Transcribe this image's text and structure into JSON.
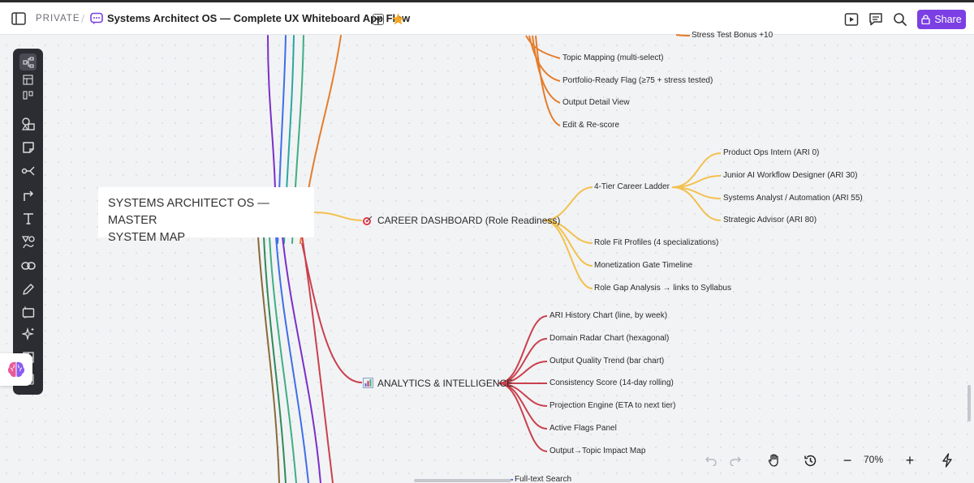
{
  "topbar": {
    "privacy": "PRIVATE",
    "separator": "/",
    "title": "Systems Architect OS — Complete UX Whiteboard App Flow",
    "share_label": "Share"
  },
  "colors": {
    "accent": "#7b3fe4",
    "orange_branch": "#e47d2c",
    "yellow_branch": "#f2c14e",
    "red_branch": "#c9414d",
    "star": "#f5a623"
  },
  "root": {
    "line1": "SYSTEMS ARCHITECT OS — MASTER",
    "line2": "SYSTEM MAP"
  },
  "nodes": {
    "stress_test": "Stress Test Bonus +10",
    "topic_mapping": "Topic Mapping (multi-select)",
    "portfolio_flag": "Portfolio-Ready Flag (≥75 + stress tested)",
    "output_detail": "Output Detail View",
    "edit_rescore": "Edit & Re-score",
    "career_dashboard": "CAREER DASHBOARD (Role Readiness)",
    "career_ladder": "4-Tier Career Ladder",
    "product_ops": "Product Ops Intern (ARI 0)",
    "junior_ai": "Junior AI Workflow Designer (ARI 30)",
    "systems_analyst": "Systems Analyst / Automation (ARI 55)",
    "strategic_advisor": "Strategic Advisor (ARI 80)",
    "role_fit": "Role Fit Profiles (4 specializations)",
    "monetization": "Monetization Gate Timeline",
    "role_gap": "Role Gap Analysis → links to Syllabus",
    "analytics": "ANALYTICS & INTELLIGENCE",
    "ari_history": "ARI History Chart (line, by week)",
    "domain_radar": "Domain Radar Chart (hexagonal)",
    "output_quality": "Output Quality Trend (bar chart)",
    "consistency": "Consistency Score (14-day rolling)",
    "projection": "Projection Engine (ETA to next tier)",
    "active_flags": "Active Flags Panel",
    "output_topic": "Output→Topic Impact Map",
    "fulltext": "Full-text Search"
  },
  "zoom": {
    "level": "70%",
    "minus": "−",
    "plus": "+"
  },
  "icons": {
    "sidebar_toggle": "sidebar-toggle-icon",
    "board": "board-icon",
    "chevron": "chevron-down-icon",
    "star": "star-icon",
    "present": "play-icon",
    "comment": "comment-icon",
    "search": "search-icon",
    "lock": "lock-icon"
  }
}
